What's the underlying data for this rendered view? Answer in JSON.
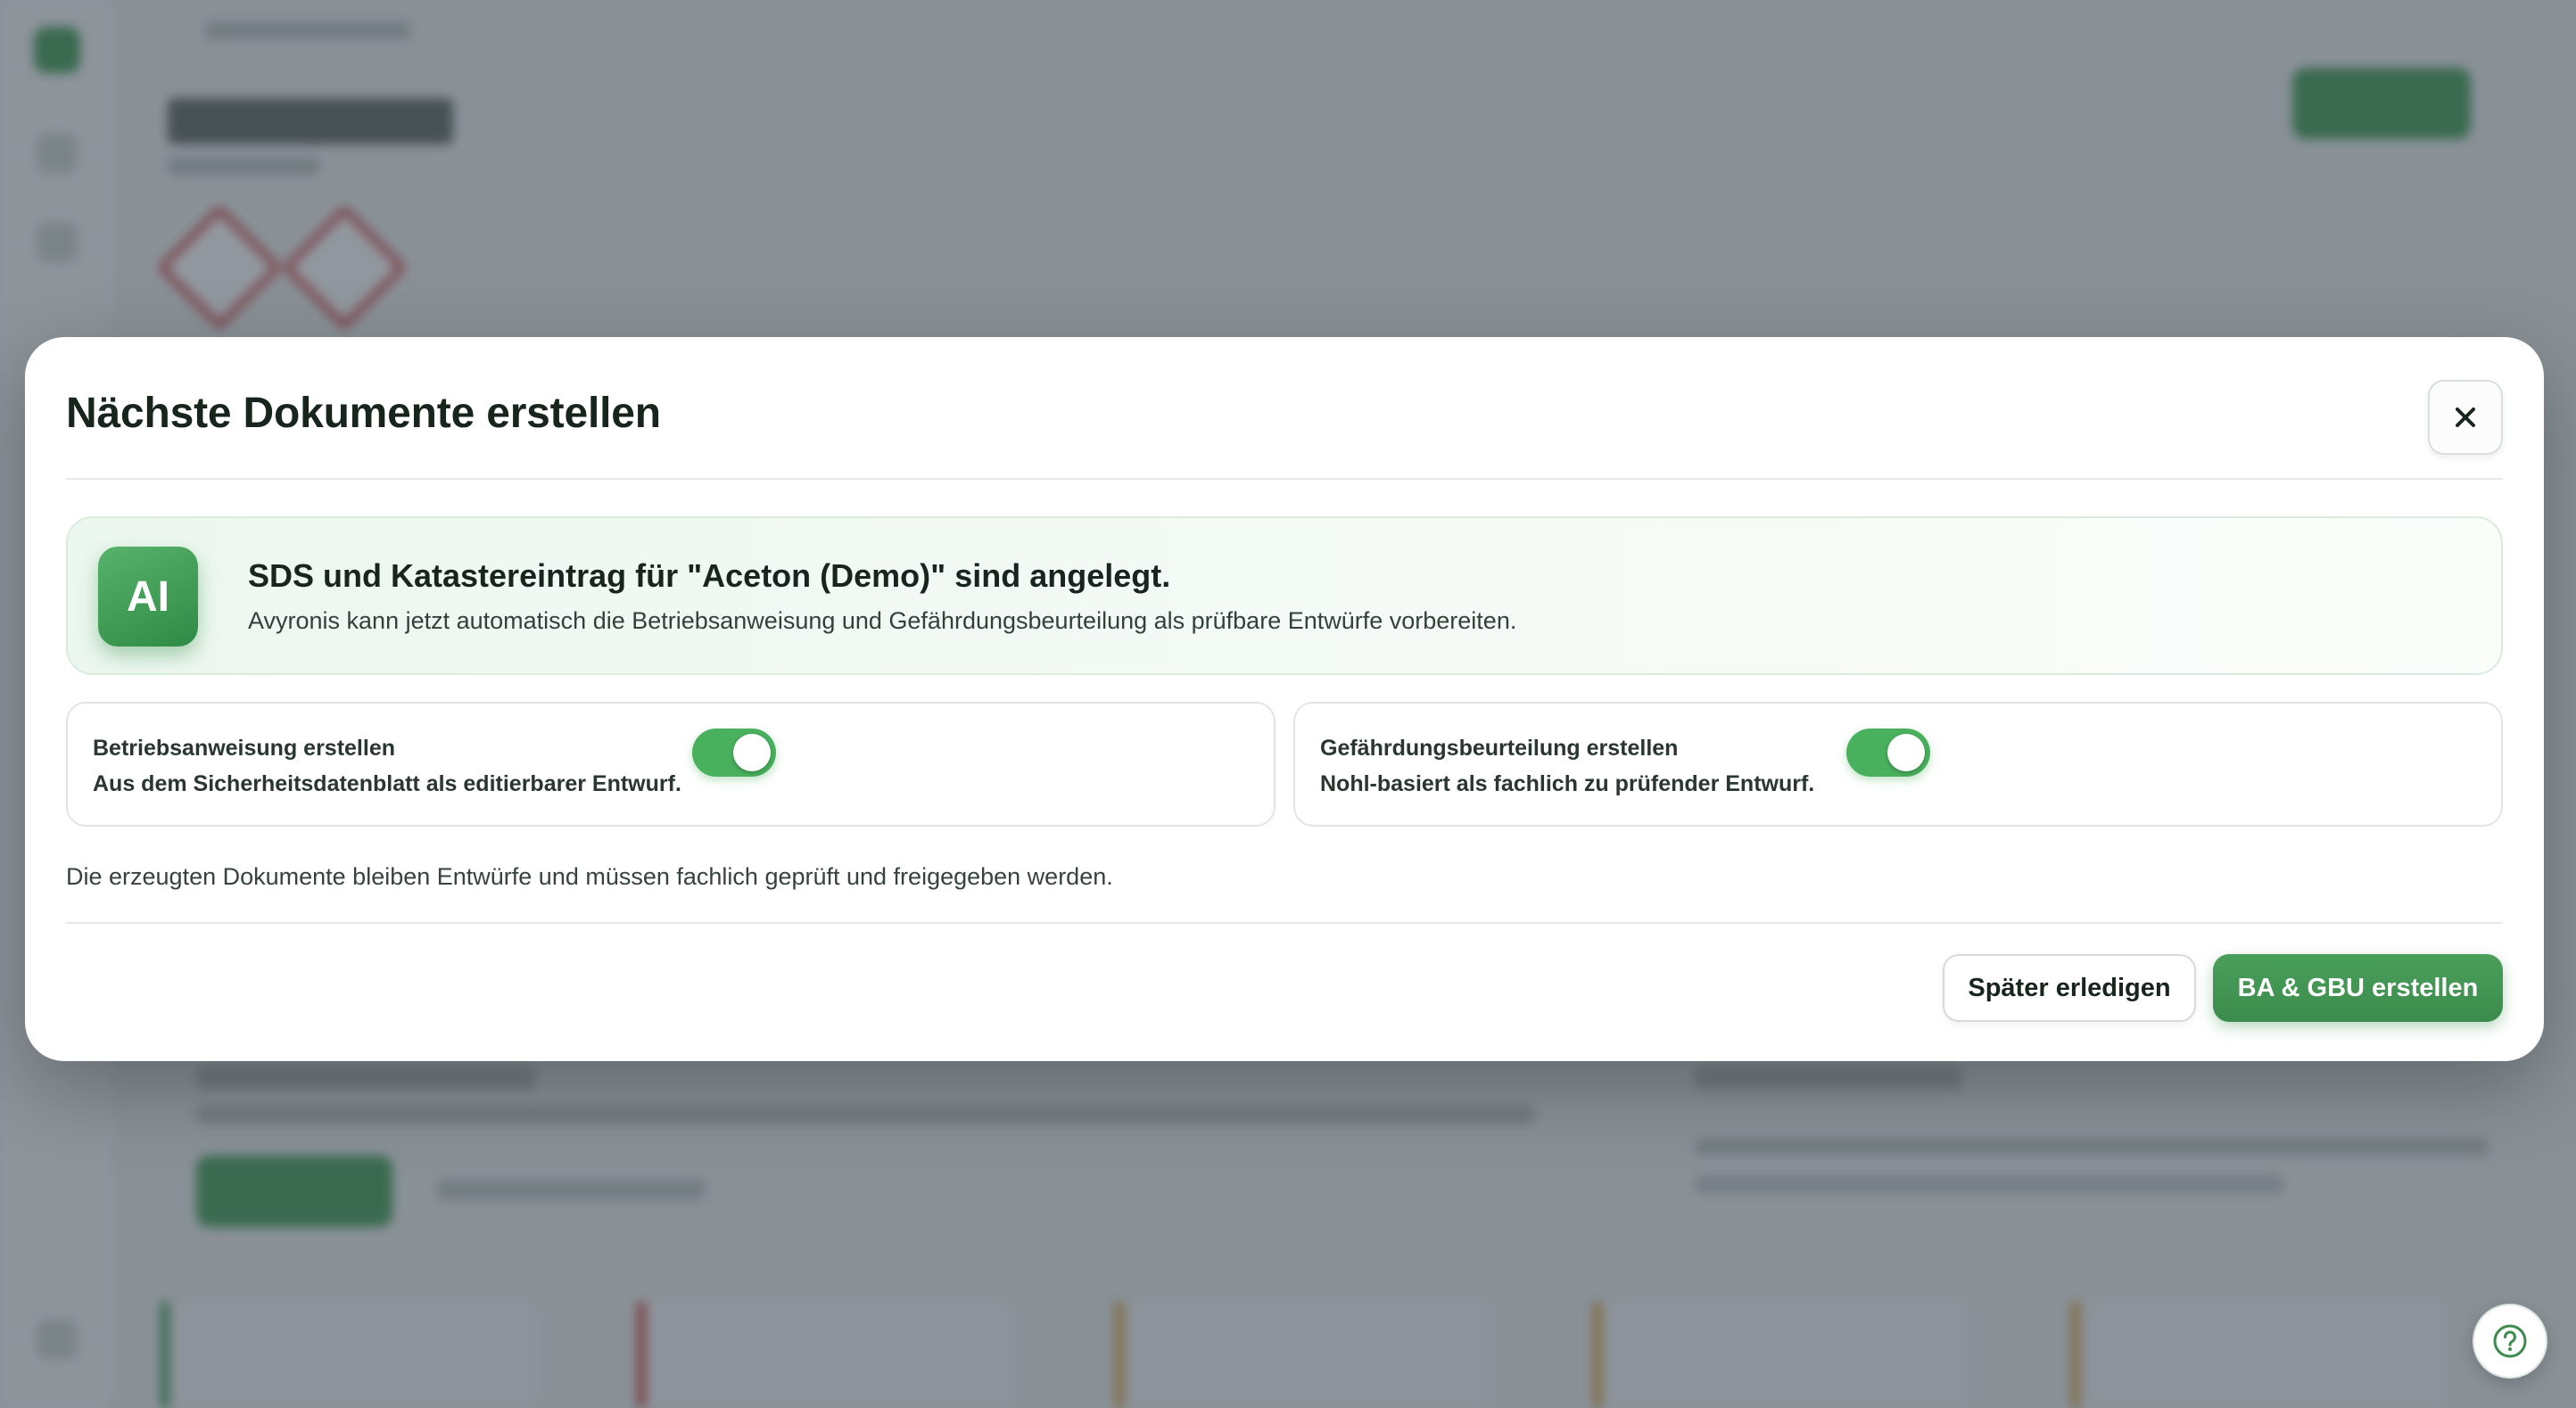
{
  "modal": {
    "title": "Nächste Dokumente erstellen",
    "close_icon": "close-icon",
    "banner": {
      "badge": "AI",
      "title": "SDS und Katastereintrag für \"Aceton (Demo)\" sind angelegt.",
      "description": "Avyronis kann jetzt automatisch die Betriebsanweisung und Gefährdungsbeurteilung als prüfbare Entwürfe vorbereiten."
    },
    "options": [
      {
        "title": "Betriebsanweisung erstellen",
        "description": "Aus dem Sicherheitsdatenblatt als editierbarer Entwurf.",
        "enabled": true
      },
      {
        "title": "Gefährdungsbeurteilung erstellen",
        "description": "Nohl-basiert als fachlich zu prüfender Entwurf.",
        "enabled": true
      }
    ],
    "footnote": "Die erzeugten Dokumente bleiben Entwürfe und müssen fachlich geprüft und freigegeben werden.",
    "buttons": {
      "later": "Später erledigen",
      "create": "BA & GBU erstellen"
    }
  },
  "help_icon": "help-circle-icon",
  "colors": {
    "accent": "#3b8b4c",
    "toggle_on": "#49b05d",
    "overlay": "#37414e"
  }
}
